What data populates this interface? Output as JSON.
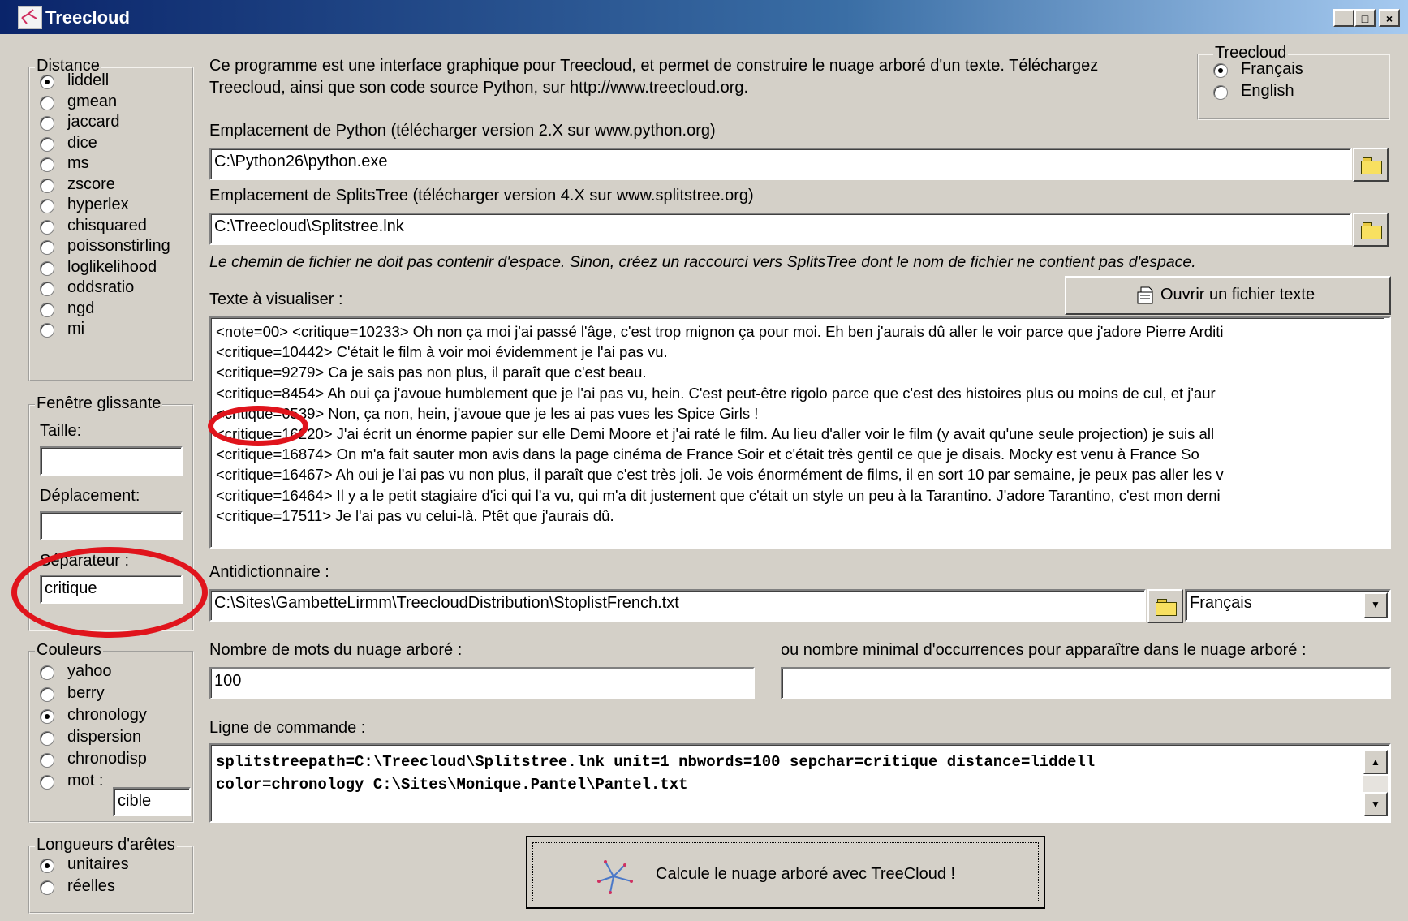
{
  "window": {
    "title": "Treecloud",
    "controls": {
      "minimize": "_",
      "maximize": "□",
      "close": "×"
    }
  },
  "distance": {
    "label": "Distance",
    "options": [
      "liddell",
      "gmean",
      "jaccard",
      "dice",
      "ms",
      "zscore",
      "hyperlex",
      "chisquared",
      "poissonstirling",
      "loglikelihood",
      "oddsratio",
      "ngd",
      "mi"
    ],
    "selected": "liddell"
  },
  "window_panel": {
    "label": "Fenêtre glissante",
    "size_label": "Taille:",
    "size_value": "",
    "shift_label": "Déplacement:",
    "shift_value": "",
    "separator_label": "Séparateur :",
    "separator_value": "critique"
  },
  "colors": {
    "label": "Couleurs",
    "options": [
      "yahoo",
      "berry",
      "chronology",
      "dispersion",
      "chronodisp",
      "mot :"
    ],
    "selected": "chronology",
    "word_value": "cible"
  },
  "edges": {
    "label": "Longueurs d'arêtes",
    "options": [
      "unitaires",
      "réelles"
    ],
    "selected": "unitaires"
  },
  "intro": {
    "line1": "Ce programme est une interface graphique pour Treecloud, et permet de construire le nuage arboré d'un texte. Téléchargez",
    "line2": "Treecloud, ainsi que son code source Python, sur http://www.treecloud.org."
  },
  "language": {
    "label": "Treecloud",
    "options": [
      "Français",
      "English"
    ],
    "selected": "Français"
  },
  "python": {
    "label": "Emplacement de Python (télécharger version 2.X sur www.python.org)",
    "value": "C:\\Python26\\python.exe"
  },
  "splitstree": {
    "label": "Emplacement de SplitsTree (télécharger version 4.X sur www.splitstree.org)",
    "value": "C:\\Treecloud\\Splitstree.lnk",
    "warning": "Le chemin de fichier ne doit pas contenir d'espace. Sinon, créez un raccourci vers SplitsTree dont le nom de fichier ne contient pas d'espace."
  },
  "text": {
    "label": "Texte à visualiser :",
    "open_button": "Ouvrir un fichier texte",
    "lines": [
      "<note=00> <critique=10233> Oh non ça moi j'ai passé l'âge, c'est trop mignon ça pour moi. Eh ben j'aurais dû aller le voir parce que j'adore Pierre Arditi",
      " <critique=10442> C'était le film à voir moi évidemment je l'ai pas vu.",
      " <critique=9279> Ca je sais pas non plus, il paraît que c'est beau.",
      " <critique=8454> Ah oui ça j'avoue humblement que je l'ai pas vu, hein. C'est peut-être rigolo parce que c'est des histoires plus ou moins de cul, et j'aur",
      " <critique=6539> Non, ça non, hein, j'avoue que je les ai pas vues  les Spice Girls  !",
      " <critique=16220> J'ai écrit un énorme papier sur elle  Demi Moore  et j'ai raté le film. Au lieu d'aller voir le film (y avait qu'une seule projection) je suis all",
      " <critique=16874> On m'a fait sauter mon avis dans la page cinéma  de France Soir  et c'était très gentil ce que je disais.  Mocky  est venu à France So",
      " <critique=16467> Ah oui je l'ai pas vu non plus, il paraît que c'est très joli. Je vois énormément de films, il en sort 10 par semaine, je peux pas aller les v",
      " <critique=16464> Il y a le petit stagiaire d'ici qui l'a vu, qui m'a dit justement que c'était un style un peu à la Tarantino. J'adore Tarantino, c'est mon derni",
      " <critique=17511> Je l'ai pas vu celui-là. Ptêt que j'aurais dû."
    ]
  },
  "stoplist": {
    "label": "Antidictionnaire :",
    "value": "C:\\Sites\\GambetteLirmm\\TreecloudDistribution\\StoplistFrench.txt",
    "language": "Français"
  },
  "counts": {
    "words_label": "Nombre de mots du nuage arboré :",
    "words_value": "100",
    "min_label": "ou nombre minimal d'occurrences pour apparaître dans le nuage arboré :",
    "min_value": ""
  },
  "command": {
    "label": "Ligne de commande :",
    "line1": "splitstreepath=C:\\Treecloud\\Splitstree.lnk unit=1 nbwords=100 sepchar=critique distance=liddell",
    "line2": "color=chronology C:\\Sites\\Monique.Pantel\\Pantel.txt"
  },
  "run": {
    "label": "Calcule le nuage arboré avec TreeCloud !"
  }
}
